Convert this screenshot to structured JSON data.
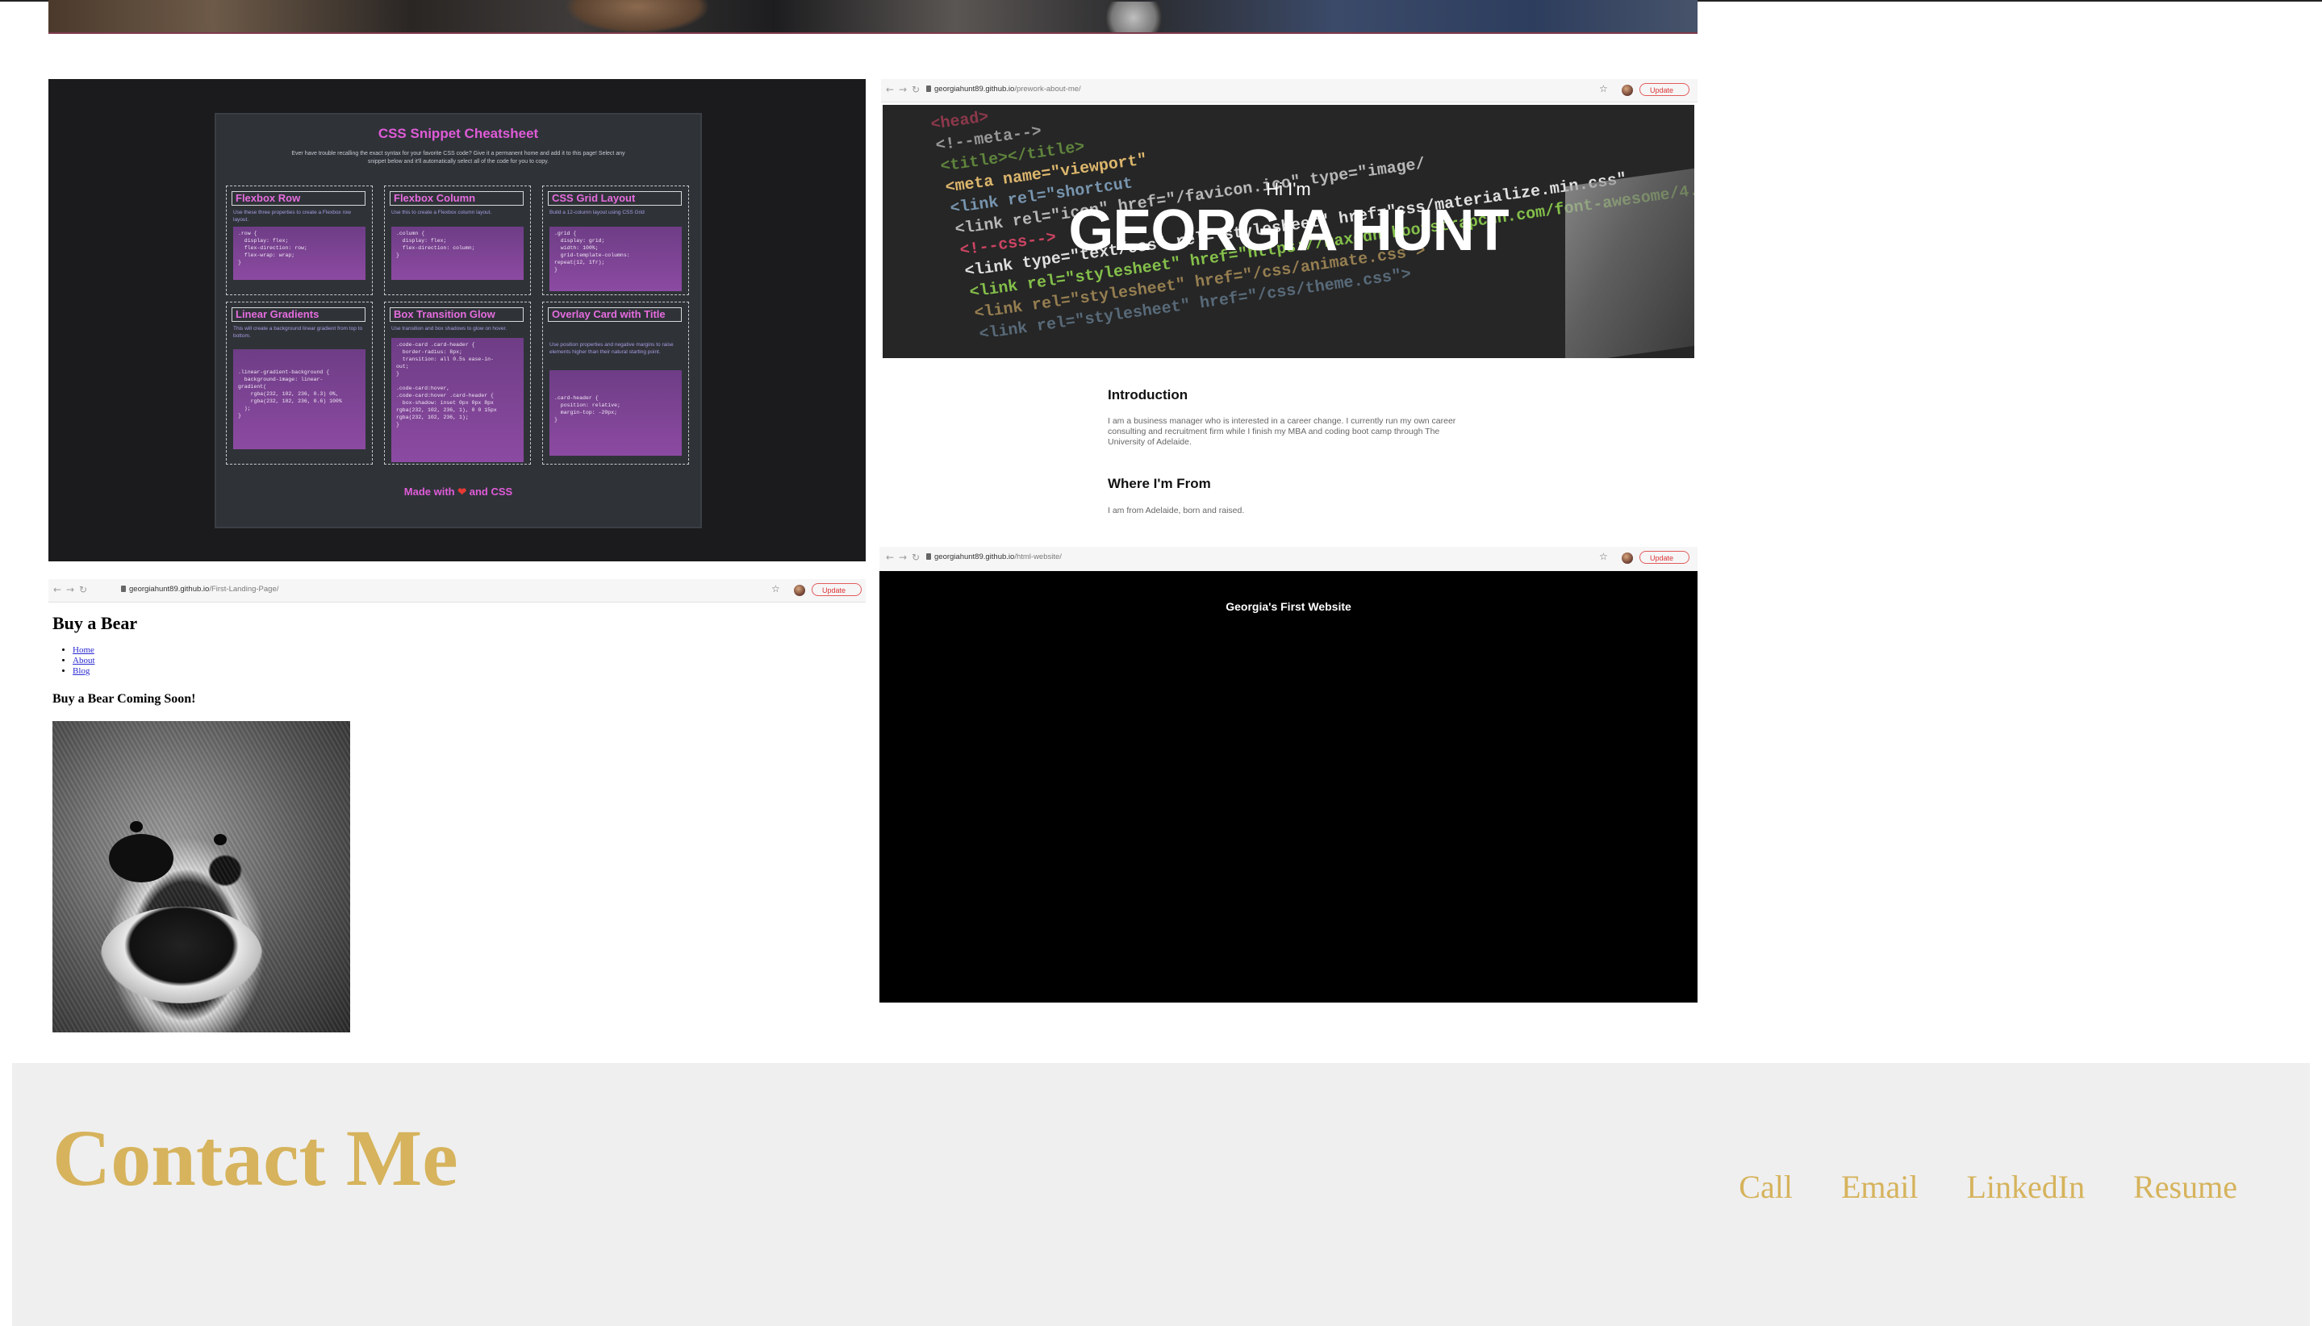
{
  "top_photo": {},
  "projects": {
    "css_cheatsheet": {
      "title": "CSS Snippet Cheatsheet",
      "intro": "Ever have trouble recalling the exact syntax for your favorite CSS code? Give it a permanent home and add it to this page! Select any snippet below and it'll automatically select all of the code for you to copy.",
      "cards": [
        {
          "label": "Flexbox Row",
          "desc": "Use these three properties to create a Flexbox row layout.",
          "code": ".row {\n  display: flex;\n  flex-direction: row;\n  flex-wrap: wrap;\n}"
        },
        {
          "label": "Flexbox Column",
          "desc": "Use this to create a Flexbox column layout.",
          "code": ".column {\n  display: flex;\n  flex-direction: column;\n}"
        },
        {
          "label": "CSS Grid Layout",
          "desc": "Build a 12-column layout using CSS Grid",
          "code": ".grid {\n  display: grid;\n  width: 100%;\n  grid-template-columns:\nrepeat(12, 1fr);\n}"
        },
        {
          "label": "Linear Gradients",
          "desc": "This will create a background linear gradient from top to bottom.",
          "code": ".linear-gradient-background {\n  background-image: linear-\ngradient(\n    rgba(232, 102, 236, 0.3) 0%,\n    rgba(232, 102, 236, 0.6) 100%\n  );\n}"
        },
        {
          "label": "Box Transition Glow",
          "desc": "Use transition and box shadows to glow on hover.",
          "code": ".code-card .card-header {\n  border-radius: 8px;\n  transition: all 0.5s ease-in-\nout;\n}\n\n.code-card:hover,\n.code-card:hover .card-header {\n  box-shadow: inset 0px 0px 8px\nrgba(232, 102, 236, 1), 0 0 15px\nrgba(232, 102, 236, 1);\n}"
        },
        {
          "label": "Overlay Card with Title",
          "desc": "Use position properties and negative margins to raise elements higher than their natural starting point.",
          "code": ".card-header {\n  position: relative;\n  margin-top: -20px;\n}"
        }
      ],
      "footer_before": "Made with ",
      "footer_heart": "❤",
      "footer_after": " and CSS"
    },
    "about_me": {
      "url_host": "georgiahunt89.github.io",
      "url_path": "/prework-about-me/",
      "update_label": "Update",
      "hero_greeting": "Hi I'm",
      "hero_name": "GEORGIA HUNT",
      "sections": [
        {
          "heading": "Introduction",
          "text": "I am a business manager who is interested in a career change. I currently run my own career consulting and recruitment firm while I finish my MBA and coding boot camp through The University of Adelaide."
        },
        {
          "heading": "Where I'm From",
          "text": "I am from Adelaide, born and raised."
        }
      ],
      "code_lines": [
        "<head>",
        "<!--meta-->",
        "<title></title>",
        "<meta name=\"viewport\"",
        "<link rel=\"shortcut",
        "<link rel=\"icon\" href=\"/favicon.ico\" type=\"image/",
        "<!--css-->",
        "<link type=\"text/css\" rel=\"stylesheet\" href=\"css/materialize.min.css\"",
        "<link rel=\"stylesheet\" href=\"https://maxcdn.bootstrapcdn.com/font-awesome/4.6.3\"",
        "<link rel=\"stylesheet\" href=\"/css/animate.css\">",
        "<link rel=\"stylesheet\" href=\"/css/theme.css\">"
      ]
    },
    "buy_a_bear": {
      "url_host": "georgiahunt89.github.io",
      "url_path": "/First-Landing-Page/",
      "update_label": "Update",
      "title": "Buy a Bear",
      "nav": [
        "Home",
        "About",
        "Blog"
      ],
      "subtitle": "Buy a Bear Coming Soon!"
    },
    "first_website": {
      "url_host": "georgiahunt89.github.io",
      "url_path": "/html-website/",
      "update_label": "Update",
      "title": "Georgia's First Website"
    }
  },
  "contact": {
    "title": "Contact Me",
    "links": [
      "Call",
      "Email",
      "LinkedIn",
      "Resume"
    ]
  },
  "colors": {
    "accent_gold": "#d6b35c",
    "cheatsheet_pink": "#e05bd8",
    "update_red": "#d33333"
  },
  "icons": [
    "back-arrow-icon",
    "forward-arrow-icon",
    "reload-icon",
    "lock-icon",
    "star-icon",
    "avatar",
    "heart-icon",
    "kebab-menu-icon"
  ]
}
